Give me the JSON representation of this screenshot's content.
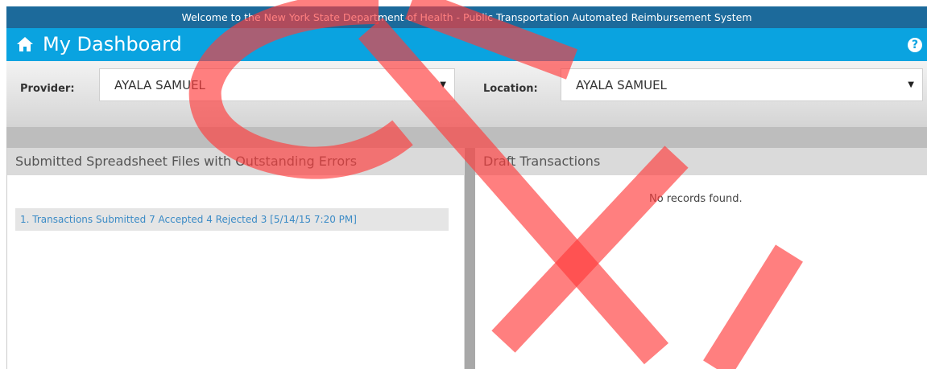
{
  "header": {
    "welcome": "Welcome to the New York State Department of Health - Public Transportation Automated Reimbursement System"
  },
  "dashboard": {
    "title": "My Dashboard",
    "home_icon": "home-icon",
    "help_icon": "question-circle-icon",
    "help_glyph": "?"
  },
  "filters": {
    "provider_label": "Provider:",
    "provider_value": "AYALA SAMUEL",
    "location_label": "Location:",
    "location_value": "AYALA SAMUEL",
    "caret": "▼"
  },
  "panels": {
    "left": {
      "title": "Submitted Spreadsheet Files with Outstanding Errors",
      "items": [
        "1. Transactions Submitted 7 Accepted 4 Rejected 3 [5/14/15 7:20 PM]"
      ]
    },
    "right": {
      "title": "Draft Transactions",
      "empty_text": "No records found."
    }
  },
  "colors": {
    "top_bar": "#1c6a9b",
    "dashboard_bar": "#0aa3e0",
    "link": "#3b8bc6",
    "watermark": "#ff3b3b"
  }
}
